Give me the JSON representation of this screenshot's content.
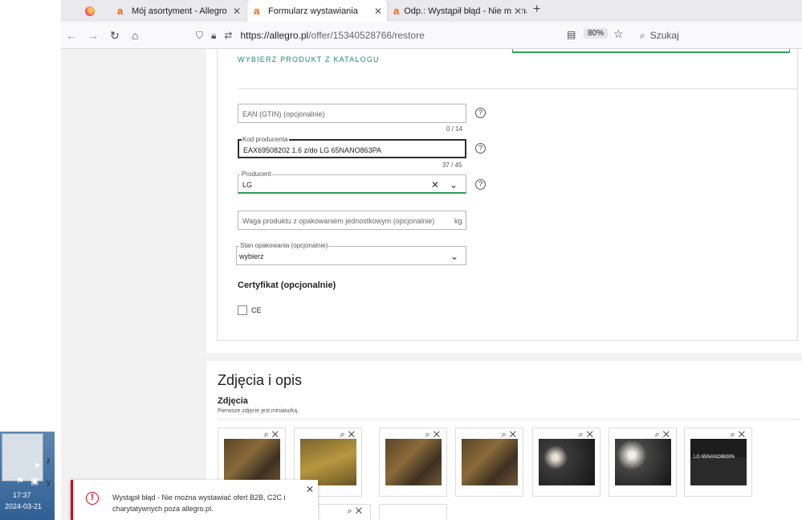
{
  "tabs": {
    "tab1": "Mój asortyment - Allegro",
    "tab2": "Formularz wystawiania",
    "tab3": "Odp.: Wystąpił błąd - Nie można"
  },
  "nav": {
    "url_host": "https://allegro.pl",
    "url_path": "/offer/15340528766/restore",
    "zoom": "80%",
    "search_placeholder": "Szukaj"
  },
  "form": {
    "catalog_link": "WYBIERZ PRODUKT Z KATALOGU",
    "ean": {
      "placeholder": "EAN (GTIN) (opcjonalnie)",
      "counter": "0 / 14"
    },
    "kod": {
      "label": "Kod producenta",
      "value": "EAX69508202 1.6  z/do  LG 65NANO863PA",
      "counter": "37 / 45"
    },
    "producent": {
      "label": "Producent",
      "value": "LG"
    },
    "waga": {
      "placeholder": "Waga produktu z opakowaniem jednostkowym (opcjonalnie)",
      "unit": "kg"
    },
    "stan": {
      "label": "Stan opakowania (opcjonalnie)",
      "value": "wybierz"
    },
    "cert_title": "Certyfikat (opcjonalnie)",
    "ce_label": "CE"
  },
  "photos": {
    "section_title": "Zdjęcia i opis",
    "title": "Zdjęcia",
    "subtitle": "Pierwsze zdjęcie jest miniaturką.",
    "label_text": "LG  65NANO863PA"
  },
  "toast": {
    "message": "Wystąpił błąd - Nie można wystawiać ofert B2B, C2C i charytatywnych poza allegro.pl."
  },
  "taskbar": {
    "time": "17:37",
    "date": "2024-03-21"
  }
}
